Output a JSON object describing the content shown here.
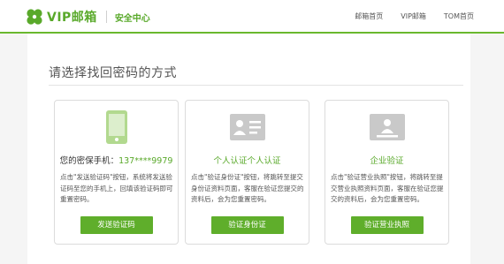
{
  "header": {
    "logo_text": "VIP邮箱",
    "section_title": "安全中心",
    "nav": [
      "邮箱首页",
      "VIP邮箱",
      "TOM首页"
    ]
  },
  "main": {
    "heading": "请选择找回密码的方式",
    "cards": [
      {
        "icon": "phone-icon",
        "title_prefix": "您的密保手机：",
        "title_value": "137****9979",
        "description": "点击\"发送验证码\"按钮，系统将发送验证码至您的手机上，回填该验证码即可重置密码。",
        "button": "发送验证码"
      },
      {
        "icon": "id-card-icon",
        "title": "个人认证个人认证",
        "description": "点击\"验证身份证\"按钮，将跳转至提交身份证资料页面，客服在验证您提交的资料后，会为您重置密码。",
        "button": "验证身份证"
      },
      {
        "icon": "business-license-icon",
        "title": "企业验证",
        "description": "点击\"验证营业执照\"按钮，将跳转至提交营业执照资料页面，客服在验证您提交的资料后，会为您重置密码。",
        "button": "验证营业执照"
      }
    ]
  },
  "colors": {
    "accent": "#5fae2b",
    "border": "#dcdcdc",
    "icon_light": "#b2d98f"
  }
}
